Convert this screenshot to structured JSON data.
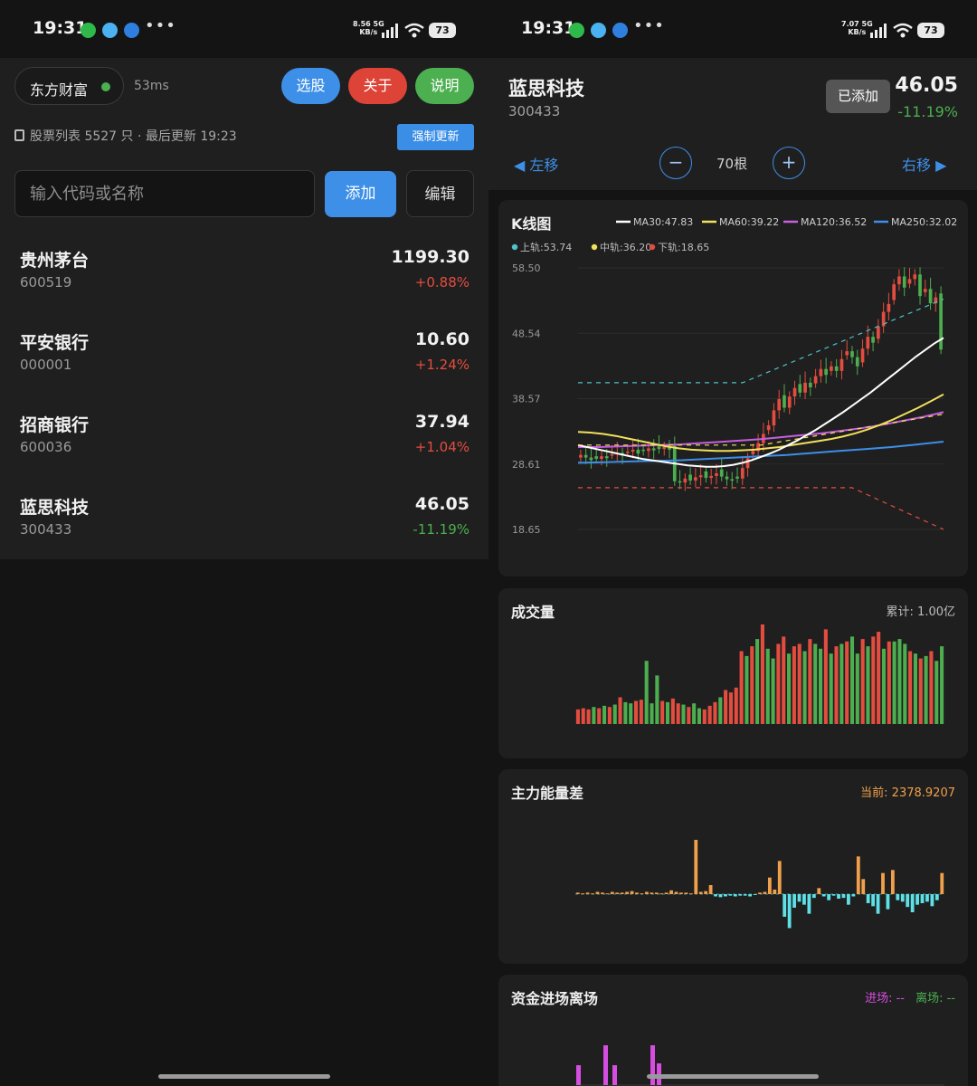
{
  "status": {
    "time": "19:31",
    "left_speed": "8.56 5G\nKB/s",
    "right_speed": "7.07 5G\nKB/s",
    "battery": "73"
  },
  "colors": {
    "up": "#e34d3f",
    "down": "#4cae4f",
    "accent": "#3d8fe8"
  },
  "left": {
    "source": "东方财富",
    "latency": "53ms",
    "buttons": {
      "pick": "选股",
      "about": "关于",
      "help": "说明"
    },
    "info": "股票列表 5527 只  ·  最后更新 19:23",
    "force_update": "强制更新",
    "search_placeholder": "输入代码或名称",
    "add_label": "添加",
    "edit_label": "编辑",
    "stocks": [
      {
        "name": "贵州茅台",
        "code": "600519",
        "price": "1199.30",
        "change": "+0.88%",
        "dir": "up"
      },
      {
        "name": "平安银行",
        "code": "000001",
        "price": "10.60",
        "change": "+1.24%",
        "dir": "up"
      },
      {
        "name": "招商银行",
        "code": "600036",
        "price": "37.94",
        "change": "+1.04%",
        "dir": "up"
      },
      {
        "name": "蓝思科技",
        "code": "300433",
        "price": "46.05",
        "change": "-11.19%",
        "dir": "down"
      }
    ]
  },
  "right": {
    "name": "蓝思科技",
    "code": "300433",
    "added_label": "已添加",
    "price": "46.05",
    "change": "-11.19%",
    "nav_left": "◀ 左移",
    "nav_right": "右移 ▶",
    "minus": "−",
    "plus": "+",
    "bar_count": "70根",
    "kline": {
      "title": "K线图",
      "legend": [
        {
          "label": "MA30:47.83",
          "color": "#ffffff"
        },
        {
          "label": "MA60:39.22",
          "color": "#f1e15b"
        },
        {
          "label": "MA120:36.52",
          "color": "#c85ee0"
        },
        {
          "label": "MA250:32.02",
          "color": "#3d8fe8"
        }
      ],
      "legend2": [
        {
          "label": "上轨:53.74",
          "color": "#4fc3c9"
        },
        {
          "label": "中轨:36.20",
          "color": "#f1e15b"
        },
        {
          "label": "下轨:18.65",
          "color": "#e34d3f"
        }
      ],
      "yticks": [
        "58.50",
        "48.54",
        "38.57",
        "28.61",
        "18.65"
      ]
    },
    "volume": {
      "title": "成交量",
      "total": "累计: 1.00亿"
    },
    "energy": {
      "title": "主力能量差",
      "current": "当前: 2378.9207"
    },
    "fund": {
      "title": "资金进场离场",
      "in_label": "进场: --",
      "out_label": "离场: --"
    }
  },
  "chart_data": [
    {
      "type": "candlestick",
      "title": "K线图",
      "ylim": [
        18.65,
        58.5
      ],
      "bars": 70,
      "close": [
        30.0,
        29.6,
        29.2,
        29.4,
        29.8,
        29.5,
        30.1,
        30.3,
        29.9,
        30.5,
        30.8,
        30.2,
        30.6,
        31.0,
        30.7,
        30.9,
        31.2,
        30.8,
        26.0,
        25.8,
        26.4,
        26.1,
        26.6,
        26.9,
        26.5,
        26.8,
        27.2,
        26.7,
        26.3,
        26.1,
        26.4,
        28.0,
        29.5,
        30.6,
        31.8,
        33.2,
        34.5,
        36.8,
        38.5,
        37.2,
        38.9,
        40.2,
        39.5,
        41.0,
        40.3,
        42.0,
        43.1,
        42.2,
        43.5,
        42.8,
        44.6,
        45.8,
        44.9,
        43.5,
        46.2,
        48.0,
        47.1,
        49.6,
        51.8,
        53.0,
        56.0,
        57.2,
        55.5,
        56.8,
        57.5,
        54.2,
        55.3,
        53.1,
        54.0,
        46.05
      ],
      "ma30": [
        31.5,
        31.2,
        30.9,
        30.6,
        30.3,
        30.0,
        29.7,
        29.4,
        29.2,
        29.0,
        28.8,
        28.6,
        28.4,
        28.3,
        28.2,
        28.2,
        28.3,
        28.5,
        28.8,
        29.2,
        29.7,
        30.2,
        30.8,
        31.5,
        32.2,
        33.0,
        33.8,
        34.7,
        35.6,
        36.5,
        37.5,
        38.5,
        39.5,
        40.6,
        41.7,
        42.8,
        43.9,
        45.0,
        46.0,
        47.0,
        47.83
      ],
      "ma60": [
        33.5,
        33.4,
        33.2,
        32.9,
        32.5,
        32.1,
        31.7,
        31.3,
        31.0,
        30.8,
        30.7,
        30.6,
        30.6,
        30.7,
        30.8,
        31.0,
        31.2,
        31.5,
        31.8,
        32.1,
        32.4,
        32.8,
        33.3,
        33.9,
        34.6,
        35.4,
        36.3,
        37.2,
        38.2,
        39.22
      ],
      "ma120": [
        31.2,
        31.2,
        31.3,
        31.4,
        31.5,
        31.6,
        31.8,
        32.0,
        32.2,
        32.4,
        32.7,
        33.0,
        33.3,
        33.7,
        34.1,
        34.6,
        35.2,
        35.8,
        36.52
      ],
      "ma250": [
        28.8,
        28.9,
        29.0,
        29.1,
        29.2,
        29.4,
        29.6,
        29.8,
        30.0,
        30.3,
        30.6,
        30.9,
        31.2,
        31.6,
        32.02
      ],
      "upper": [
        53.74
      ],
      "middle": [
        36.2
      ],
      "lower": [
        18.65
      ]
    },
    {
      "type": "bar",
      "title": "成交量",
      "values": [
        12,
        13,
        12,
        14,
        13,
        15,
        14,
        16,
        22,
        18,
        17,
        19,
        20,
        52,
        17,
        40,
        19,
        18,
        21,
        17,
        16,
        14,
        17,
        13,
        12,
        15,
        18,
        22,
        28,
        26,
        30,
        60,
        56,
        64,
        70,
        82,
        62,
        54,
        66,
        72,
        58,
        64,
        66,
        60,
        70,
        66,
        62,
        78,
        58,
        64,
        66,
        68,
        72,
        58,
        70,
        64,
        72,
        76,
        62,
        68,
        68,
        70,
        66,
        60,
        58,
        54,
        56,
        60,
        52,
        64
      ],
      "dir": [
        "u",
        "u",
        "u",
        "d",
        "u",
        "d",
        "u",
        "d",
        "u",
        "d",
        "d",
        "u",
        "u",
        "d",
        "d",
        "d",
        "u",
        "d",
        "u",
        "u",
        "d",
        "u",
        "d",
        "d",
        "u",
        "u",
        "u",
        "d",
        "u",
        "u",
        "u",
        "u",
        "d",
        "u",
        "d",
        "u",
        "d",
        "d",
        "u",
        "u",
        "d",
        "u",
        "u",
        "d",
        "u",
        "d",
        "d",
        "u",
        "d",
        "u",
        "d",
        "u",
        "d",
        "d",
        "u",
        "d",
        "u",
        "u",
        "d",
        "u",
        "d",
        "d",
        "d",
        "u",
        "d",
        "u",
        "d",
        "u",
        "d",
        "d"
      ]
    },
    {
      "type": "bar",
      "title": "主力能量差",
      "values": [
        2,
        1,
        2,
        1,
        3,
        2,
        1,
        3,
        2,
        2,
        3,
        4,
        2,
        1,
        3,
        2,
        2,
        1,
        2,
        5,
        3,
        2,
        2,
        1,
        72,
        3,
        4,
        12,
        -3,
        -4,
        -3,
        -2,
        -3,
        -2,
        -2,
        -3,
        -1,
        2,
        3,
        22,
        6,
        44,
        -30,
        -45,
        -18,
        -10,
        -14,
        -26,
        -5,
        8,
        -3,
        -8,
        -2,
        -6,
        -5,
        -14,
        -3,
        50,
        20,
        -12,
        -16,
        -26,
        28,
        -20,
        32,
        -8,
        -10,
        -17,
        -24,
        -14,
        -12,
        -10,
        -16,
        -8,
        28
      ],
      "current": 2378.9207
    }
  ]
}
